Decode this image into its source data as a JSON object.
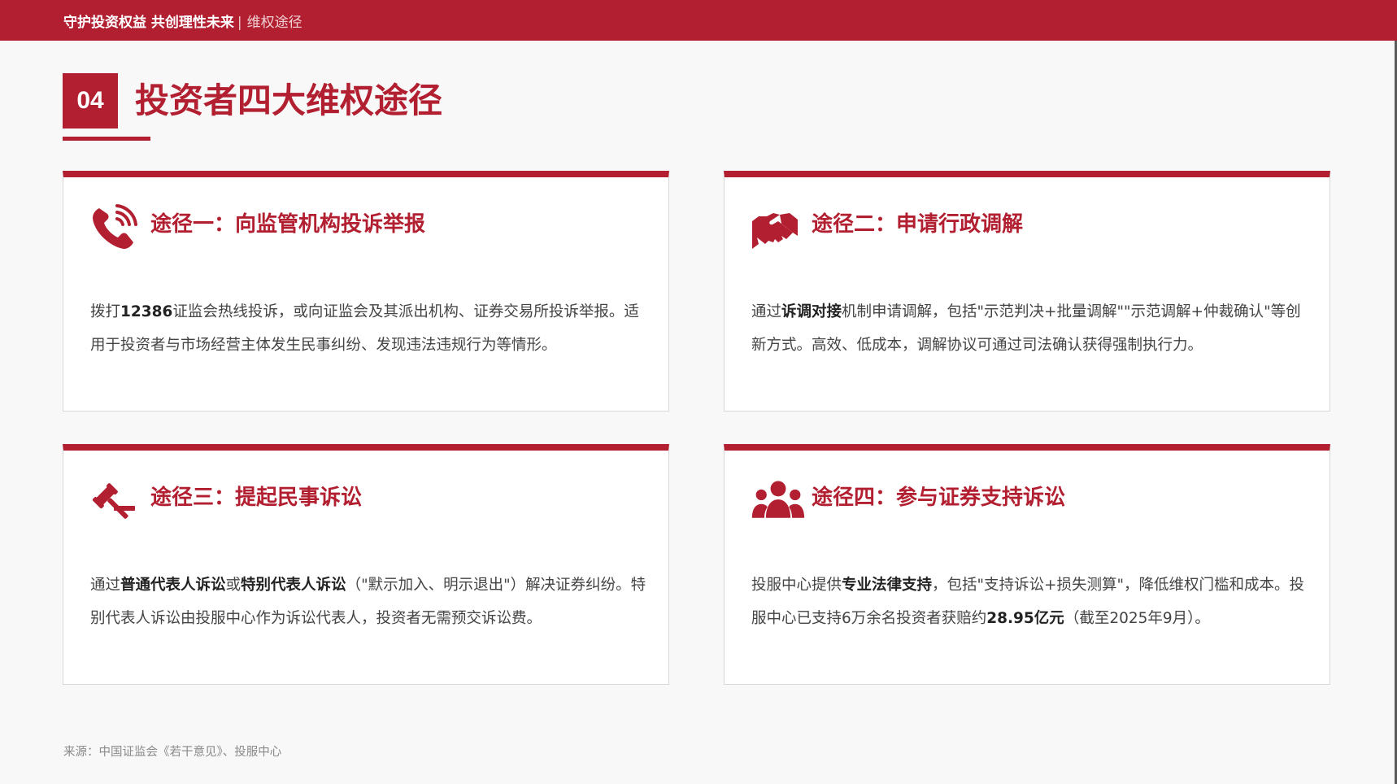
{
  "header": {
    "brand": "守护投资权益 共创理性未来",
    "separator": "|",
    "section": "维权途径"
  },
  "page": {
    "number": "04",
    "title": "投资者四大维权途径"
  },
  "colors": {
    "accent": "#b21f30",
    "background": "#f8f8f8",
    "card": "#ffffff"
  },
  "cards": [
    {
      "icon": "phone-icon",
      "title": "途径一：向监管机构投诉举报",
      "body": [
        {
          "t": "拨打",
          "b": false
        },
        {
          "t": "12386",
          "b": true
        },
        {
          "t": "证监会热线投诉，或向证监会及其派出机构、证券交易所投诉举报。适用于投资者与市场经营主体发生民事纠纷、发现违法违规行为等情形。",
          "b": false
        }
      ]
    },
    {
      "icon": "handshake-icon",
      "title": "途径二：申请行政调解",
      "body": [
        {
          "t": "通过",
          "b": false
        },
        {
          "t": "诉调对接",
          "b": true
        },
        {
          "t": "机制申请调解，包括\"示范判决+批量调解\"\"示范调解+仲裁确认\"等创新方式。高效、低成本，调解协议可通过司法确认获得强制执行力。",
          "b": false
        }
      ]
    },
    {
      "icon": "gavel-icon",
      "title": "途径三：提起民事诉讼",
      "body": [
        {
          "t": "通过",
          "b": false
        },
        {
          "t": "普通代表人诉讼",
          "b": true
        },
        {
          "t": "或",
          "b": false
        },
        {
          "t": "特别代表人诉讼",
          "b": true
        },
        {
          "t": "（\"默示加入、明示退出\"）解决证券纠纷。特别代表人诉讼由投服中心作为诉讼代表人，投资者无需预交诉讼费。",
          "b": false
        }
      ]
    },
    {
      "icon": "group-users-icon",
      "title": "途径四：参与证券支持诉讼",
      "body": [
        {
          "t": "投服中心提供",
          "b": false
        },
        {
          "t": "专业法律支持",
          "b": true
        },
        {
          "t": "，包括\"支持诉讼+损失测算\"，降低维权门槛和成本。投服中心已支持6万余名投资者获赔约",
          "b": false
        },
        {
          "t": "28.95亿元",
          "b": true
        },
        {
          "t": "（截至2025年9月）。",
          "b": false
        }
      ]
    }
  ],
  "footer": {
    "source": "来源：中国证监会《若干意见》、投服中心"
  }
}
